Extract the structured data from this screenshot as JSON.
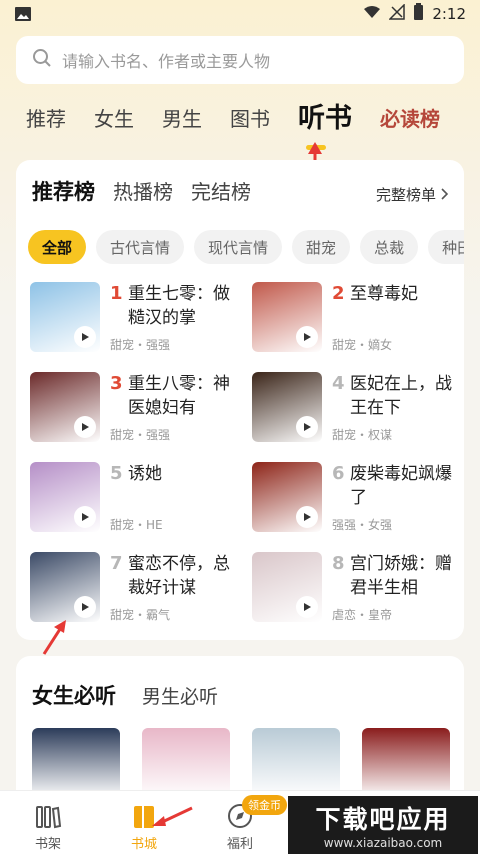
{
  "status": {
    "time": "2:12"
  },
  "search": {
    "placeholder": "请输入书名、作者或主要人物"
  },
  "tabs": [
    "推荐",
    "女生",
    "男生",
    "图书",
    "听书",
    "必读榜"
  ],
  "rank_section": {
    "tabs": [
      "推荐榜",
      "热播榜",
      "完结榜"
    ],
    "more": "完整榜单"
  },
  "chips": [
    "全部",
    "古代言情",
    "现代言情",
    "甜宠",
    "总裁",
    "种田"
  ],
  "books": [
    {
      "rank": "1",
      "title": "重生七零：做糙汉的掌",
      "tags": "甜宠・强强",
      "cover_color": "#8ec2e6"
    },
    {
      "rank": "2",
      "title": "至尊毒妃",
      "tags": "甜宠・嫡女",
      "cover_color": "#c0584a"
    },
    {
      "rank": "3",
      "title": "重生八零：神医媳妇有",
      "tags": "甜宠・强强",
      "cover_color": "#6b2a2a"
    },
    {
      "rank": "4",
      "title": "医妃在上，战王在下",
      "tags": "甜宠・权谋",
      "cover_color": "#3a2418"
    },
    {
      "rank": "5",
      "title": "诱她",
      "tags": "甜宠・HE",
      "cover_color": "#b58fc7"
    },
    {
      "rank": "6",
      "title": "废柴毒妃飒爆了",
      "tags": "强强・女强",
      "cover_color": "#8d2418"
    },
    {
      "rank": "7",
      "title": "蜜恋不停，总裁好计谋",
      "tags": "甜宠・霸气",
      "cover_color": "#3b4a66"
    },
    {
      "rank": "8",
      "title": "宫门娇娥：赠君半生相",
      "tags": "虐恋・皇帝",
      "cover_color": "#d9c6c9"
    }
  ],
  "must_section": {
    "tabs": [
      "女生必听",
      "男生必听"
    ]
  },
  "must_covers": [
    "#2c3c5a",
    "#e8b7c8",
    "#b9cbd6",
    "#8a1d1d"
  ],
  "bottom_nav": [
    "书架",
    "书城",
    "福利"
  ],
  "badge": "领金币",
  "watermark": {
    "line1": "下载吧应用",
    "line2": "www.xiazaibao.com"
  },
  "colors": {
    "accent": "#f7c421",
    "rank_top": "#e04a35",
    "rank_normal": "#b7b7b7"
  }
}
